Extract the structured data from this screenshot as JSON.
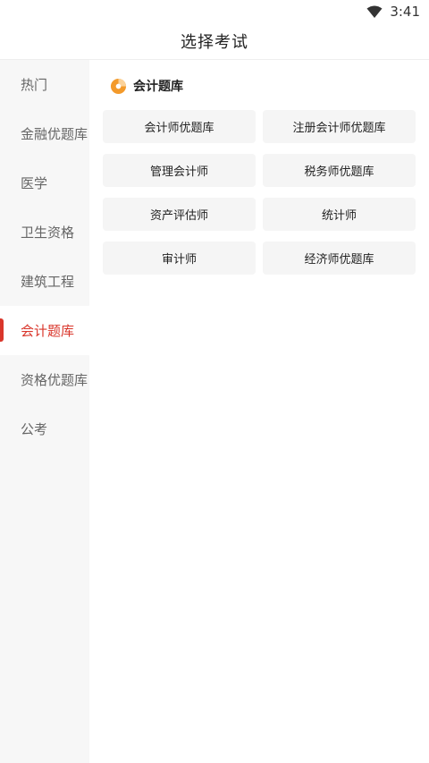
{
  "status_bar": {
    "time": "3:41",
    "wifi_icon": "wifi-icon"
  },
  "header": {
    "title": "选择考试"
  },
  "sidebar": {
    "items": [
      {
        "label": "热门",
        "active": false
      },
      {
        "label": "金融优题库",
        "active": false
      },
      {
        "label": "医学",
        "active": false
      },
      {
        "label": "卫生资格",
        "active": false
      },
      {
        "label": "建筑工程",
        "active": false
      },
      {
        "label": "会计题库",
        "active": true
      },
      {
        "label": "资格优题库",
        "active": false
      },
      {
        "label": "公考",
        "active": false
      }
    ]
  },
  "main": {
    "section_icon": "pie-chart-icon",
    "section_title": "会计题库",
    "options": [
      "会计师优题库",
      "注册会计师优题库",
      "管理会计师",
      "税务师优题库",
      "资产评估师",
      "统计师",
      "审计师",
      "经济师优题库"
    ]
  },
  "colors": {
    "accent": "#d9362b",
    "sidebar_bg": "#f7f7f7",
    "option_bg": "#f5f5f5",
    "pie_orange": "#f39a2b",
    "pie_light": "#fbd29a"
  }
}
